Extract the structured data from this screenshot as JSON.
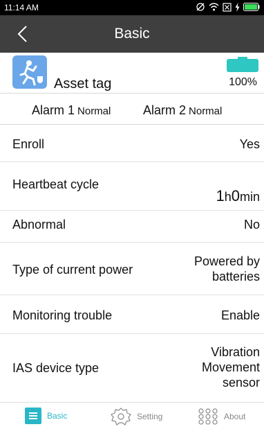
{
  "status": {
    "time": "11:14 AM"
  },
  "header": {
    "title": "Basic"
  },
  "device": {
    "name": "Asset tag",
    "battery": "100%",
    "battery_level": 1.0
  },
  "alarms": [
    {
      "label": "Alarm 1",
      "state": "Normal"
    },
    {
      "label": "Alarm 2",
      "state": "Normal"
    }
  ],
  "rows": [
    {
      "label": "Enroll",
      "value": "Yes"
    },
    {
      "label": "Heartbeat cycle",
      "value_parts": [
        "1",
        "h",
        "0",
        "min"
      ]
    },
    {
      "label": "Abnormal",
      "value": "No"
    },
    {
      "label": "Type of current power",
      "value_lines": [
        "Powered by",
        "batteries"
      ]
    },
    {
      "label": "Monitoring trouble",
      "value": "Enable"
    },
    {
      "label": "IAS device type",
      "value_lines": [
        "Vibration",
        "Movement",
        "sensor"
      ]
    }
  ],
  "tabs": [
    {
      "label": "Basic",
      "icon": "list-icon",
      "active": true
    },
    {
      "label": "Setting",
      "icon": "gear-icon",
      "active": false
    },
    {
      "label": "About",
      "icon": "dots-grid-icon",
      "active": false
    }
  ],
  "colors": {
    "accent": "#2bb6c8",
    "header_bg": "#3f3f3f",
    "battery": "#2ec7c1",
    "device_icon_bg": "#6aa6e8"
  }
}
